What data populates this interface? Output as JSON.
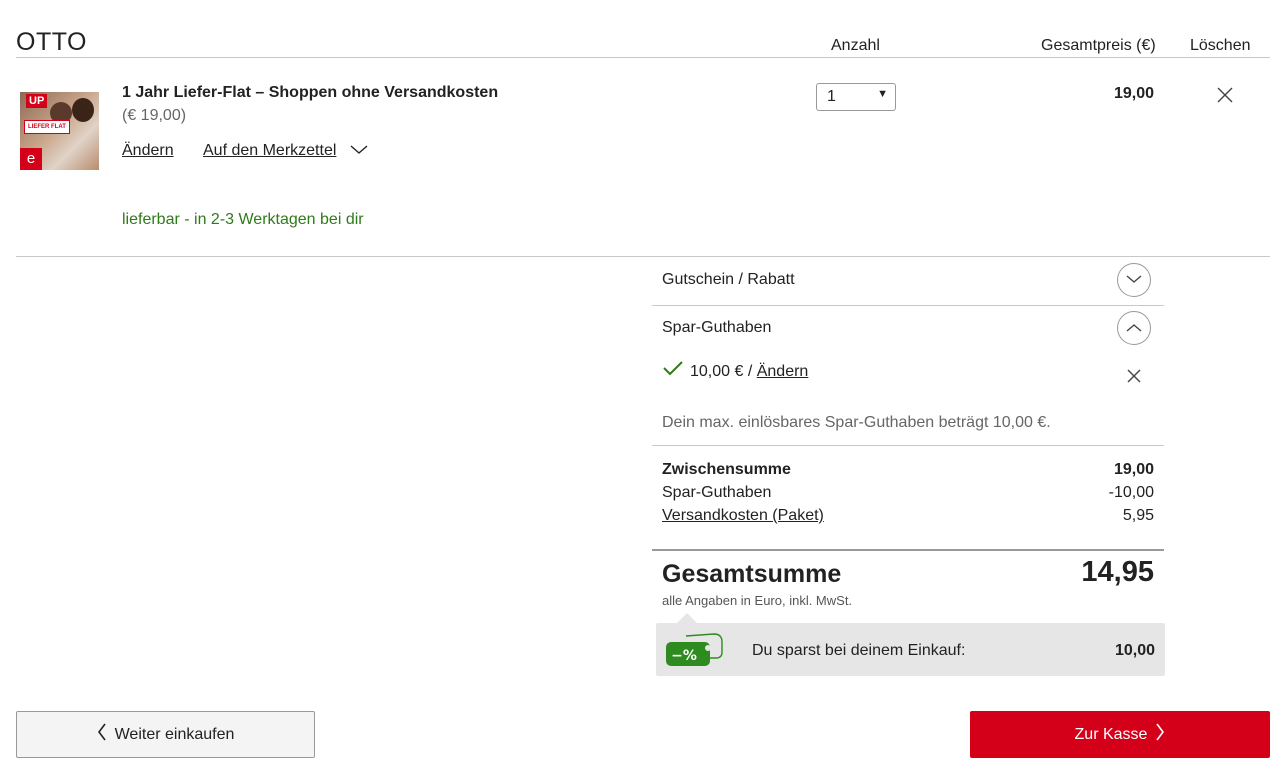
{
  "header": {
    "brand": "OTTO",
    "col_quantity": "Anzahl",
    "col_total": "Gesamtpreis (€)",
    "col_delete": "Löschen"
  },
  "item": {
    "title": "1 Jahr Liefer-Flat – Shoppen ohne Versandkosten",
    "unit_price": "(€ 19,00)",
    "edit_link": "Ändern",
    "wishlist_link": "Auf den Merkzettel",
    "availability": "lieferbar - in 2-3 Werktagen bei dir",
    "quantity": "1",
    "total": "19,00",
    "thumb_badge_up": "UP",
    "thumb_badge_liefer": "LIEFER FLAT",
    "thumb_box": "e"
  },
  "voucher": {
    "label": "Gutschein / Rabatt"
  },
  "savings_credit": {
    "label": "Spar-Guthaben",
    "applied_amount": "10,00 € /",
    "change_link": "Ändern",
    "info": "Dein max. einlösbares Spar-Guthaben beträgt 10,00 €."
  },
  "summary": {
    "subtotal_label": "Zwischensumme",
    "subtotal_value": "19,00",
    "credit_label": "Spar-Guthaben",
    "credit_value": "-10,00",
    "shipping_label": "Versandkosten (Paket)",
    "shipping_value": "5,95",
    "grand_label": "Gesamtsumme",
    "grand_value": "14,95",
    "grand_note": "alle Angaben in Euro, inkl. MwSt.",
    "savings_text": "Du sparst bei deinem Einkauf:",
    "savings_value": "10,00",
    "savings_icon_text": "−%"
  },
  "actions": {
    "back_label": "Weiter einkaufen",
    "checkout_label": "Zur Kasse"
  },
  "colors": {
    "brand_red": "#d4001a",
    "success_green": "#2f7a1a",
    "savings_green": "#2e8b1f"
  }
}
